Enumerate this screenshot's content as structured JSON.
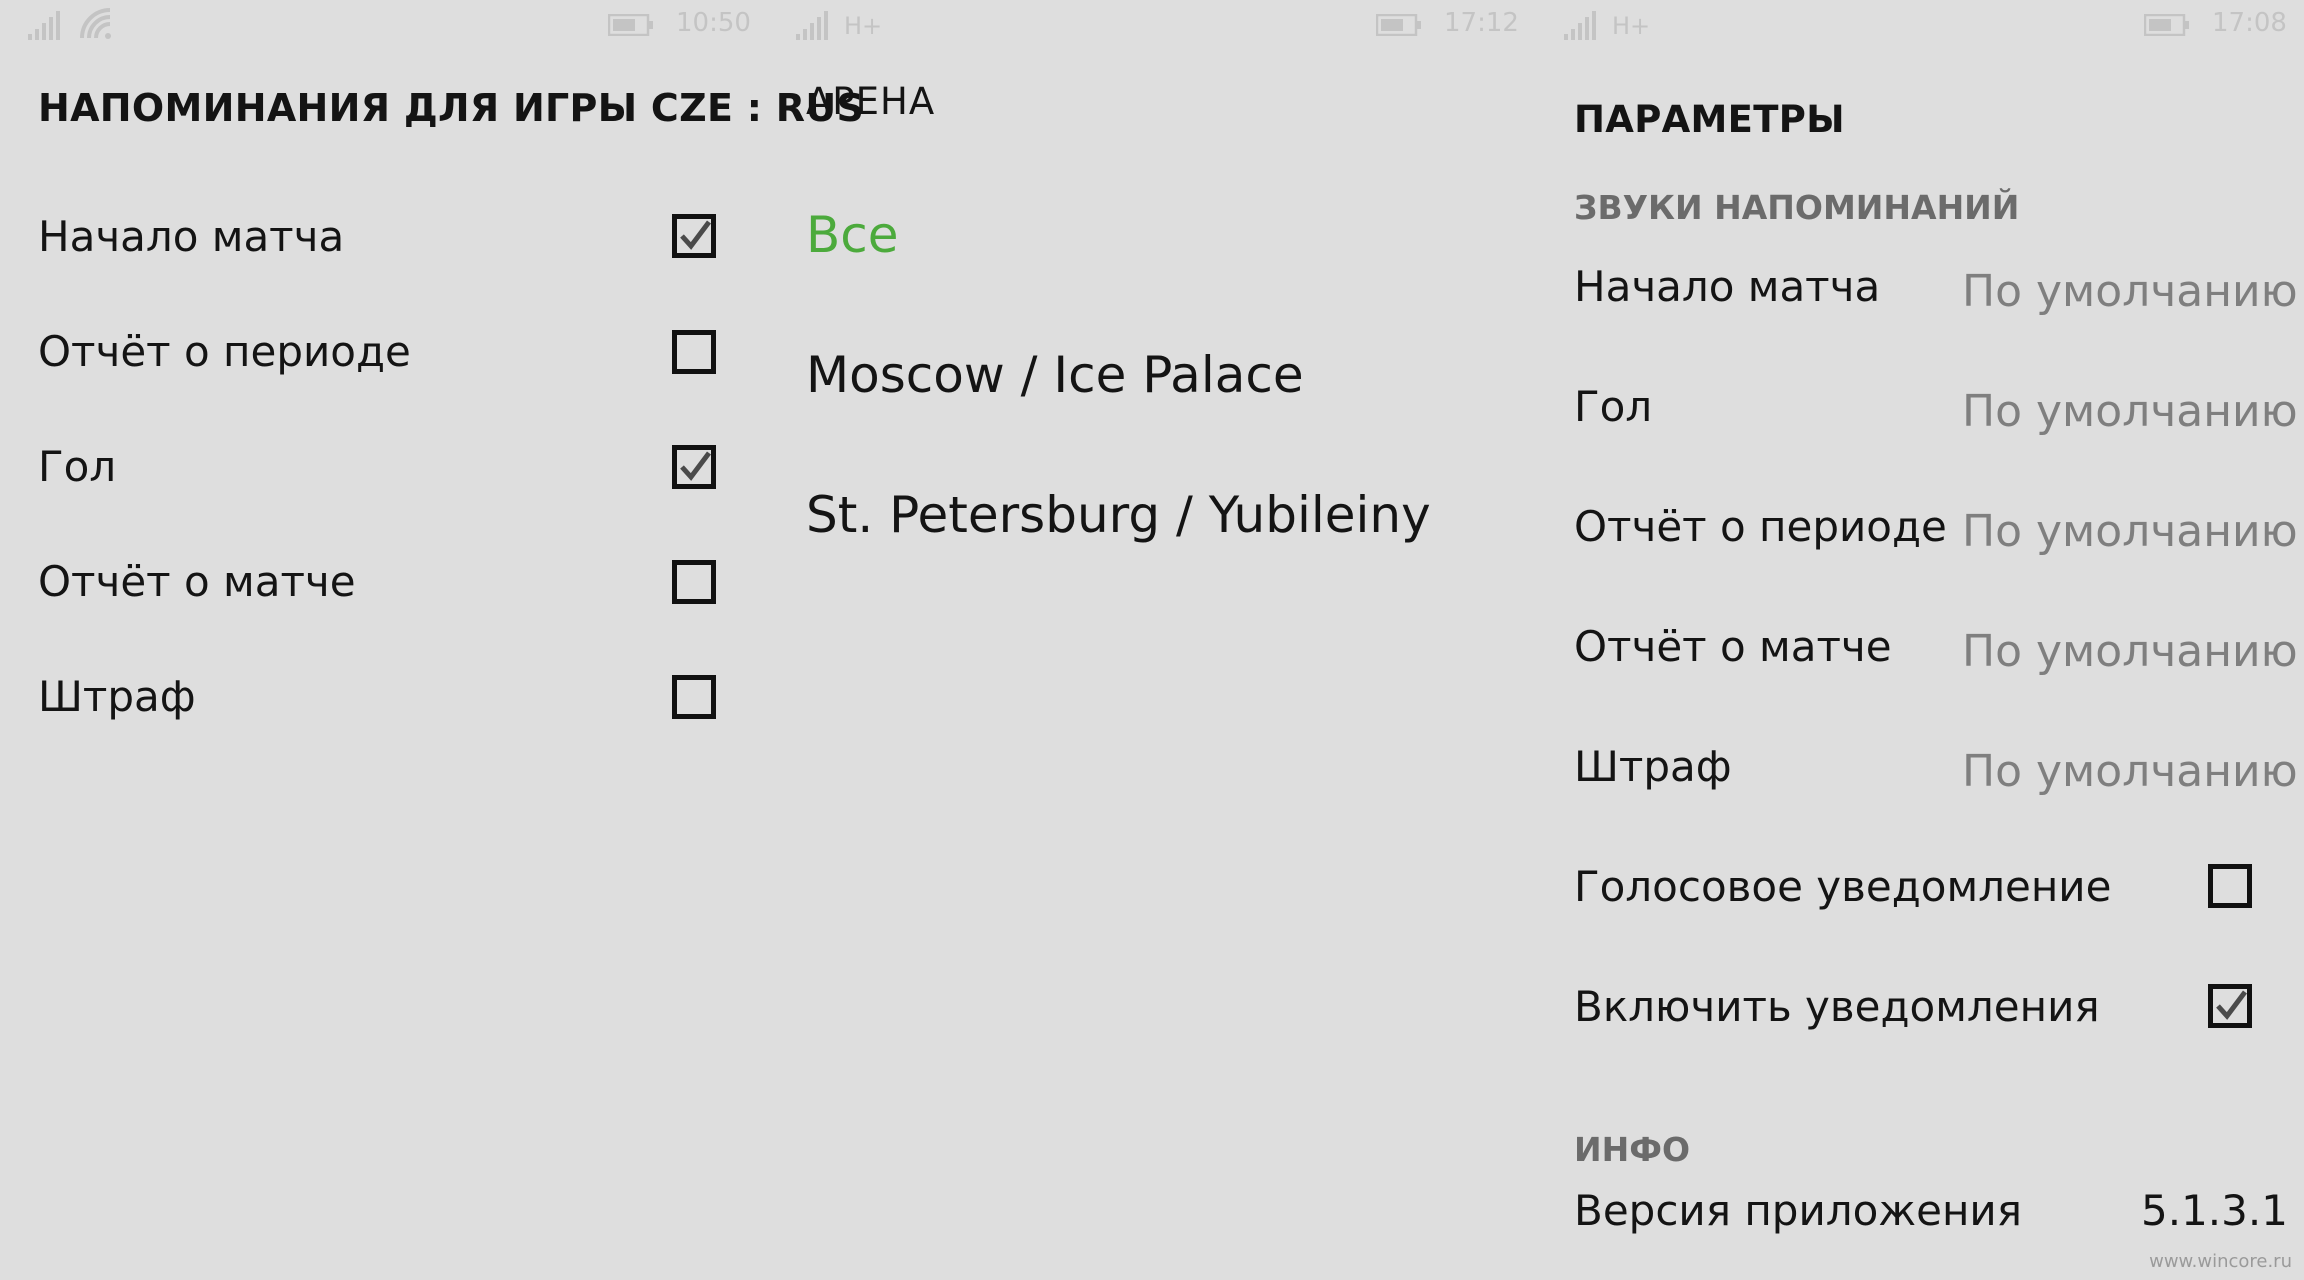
{
  "colors": {
    "background": "#dedede",
    "accent": "#4caa3c",
    "text": "#141414",
    "muted": "#7f7f7f"
  },
  "screens": [
    {
      "status": {
        "network": "",
        "time": "10:50"
      },
      "title": "НАПОМИНАНИЯ ДЛЯ ИГРЫ CZE : RUS",
      "items": [
        {
          "label": "Начало матча",
          "checked": true
        },
        {
          "label": "Отчёт о периоде",
          "checked": false
        },
        {
          "label": "Гол",
          "checked": true
        },
        {
          "label": "Отчёт о матче",
          "checked": false
        },
        {
          "label": "Штраф",
          "checked": false
        }
      ]
    },
    {
      "status": {
        "network": "H+",
        "time": "17:12"
      },
      "title": "АРЕНА",
      "options": [
        {
          "label": "Все",
          "selected": true
        },
        {
          "label": "Moscow / Ice Palace",
          "selected": false
        },
        {
          "label": "St. Petersburg / Yubileiny",
          "selected": false
        }
      ]
    },
    {
      "status": {
        "network": "H+",
        "time": "17:08"
      },
      "title": "ПАРАМЕТРЫ",
      "sounds_header": "ЗВУКИ НАПОМИНАНИЙ",
      "sounds": [
        {
          "label": "Начало матча",
          "value": "По умолчанию"
        },
        {
          "label": "Гол",
          "value": "По умолчанию"
        },
        {
          "label": "Отчёт о периоде",
          "value": "По умолчанию"
        },
        {
          "label": "Отчёт о матче",
          "value": "По умолчанию"
        },
        {
          "label": "Штраф",
          "value": "По умолчанию"
        }
      ],
      "toggles": [
        {
          "label": "Голосовое уведомление",
          "checked": false
        },
        {
          "label": "Включить уведомления",
          "checked": true
        }
      ],
      "info_header": "ИНФО",
      "version_label": "Версия приложения",
      "version_value": "5.1.3.1"
    }
  ],
  "watermark": "www.wincore.ru"
}
